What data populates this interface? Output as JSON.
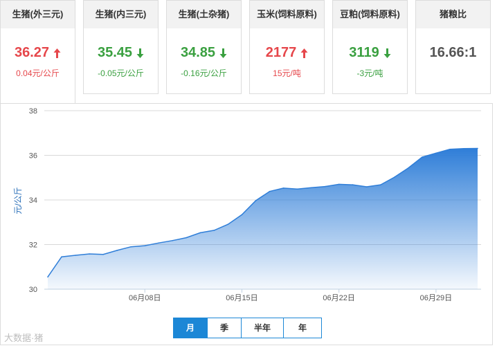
{
  "cards": [
    {
      "title": "生猪(外三元)",
      "price": "36.27",
      "change": "0.04元/公斤",
      "trend": "up"
    },
    {
      "title": "生猪(内三元)",
      "price": "35.45",
      "change": "-0.05元/公斤",
      "trend": "down"
    },
    {
      "title": "生猪(土杂猪)",
      "price": "34.85",
      "change": "-0.16元/公斤",
      "trend": "down"
    },
    {
      "title": "玉米(饲料原料)",
      "price": "2177",
      "change": "15元/吨",
      "trend": "up"
    },
    {
      "title": "豆粕(饲料原料)",
      "price": "3119",
      "change": "-3元/吨",
      "trend": "down"
    },
    {
      "title": "猪粮比",
      "price": "16.66:1",
      "change": "",
      "trend": "flat"
    }
  ],
  "colors": {
    "up": "#e6474b",
    "down": "#3aa040",
    "area": "#2f7ed8",
    "accent": "#1c87d6"
  },
  "range_buttons": [
    "月",
    "季",
    "半年",
    "年"
  ],
  "active_range": "月",
  "watermark": "大数据·猪",
  "chart_data": {
    "type": "area",
    "ylabel": "元/公斤",
    "xlabel": "",
    "ylim": [
      30,
      38
    ],
    "yticks": [
      30,
      32,
      34,
      36,
      38
    ],
    "x_tick_labels": [
      "06月08日",
      "06月15日",
      "06月22日",
      "06月29日"
    ],
    "x_tick_days": [
      8,
      15,
      22,
      29
    ],
    "x_range_days": [
      1,
      32
    ],
    "grid": true,
    "series": [
      {
        "days": [
          1,
          2,
          3,
          4,
          5,
          6,
          7,
          8,
          9,
          10,
          11,
          12,
          13,
          14,
          15,
          16,
          17,
          18,
          19,
          20,
          21,
          22,
          23,
          24,
          25,
          26,
          27,
          28,
          29,
          30,
          31,
          32
        ],
        "values": [
          30.55,
          31.45,
          31.52,
          31.58,
          31.56,
          31.74,
          31.9,
          31.95,
          32.07,
          32.18,
          32.31,
          32.53,
          32.64,
          32.91,
          33.34,
          33.97,
          34.38,
          34.53,
          34.49,
          34.55,
          34.6,
          34.7,
          34.68,
          34.59,
          34.68,
          35.02,
          35.43,
          35.92,
          36.1,
          36.27,
          36.3,
          36.31
        ]
      }
    ]
  }
}
